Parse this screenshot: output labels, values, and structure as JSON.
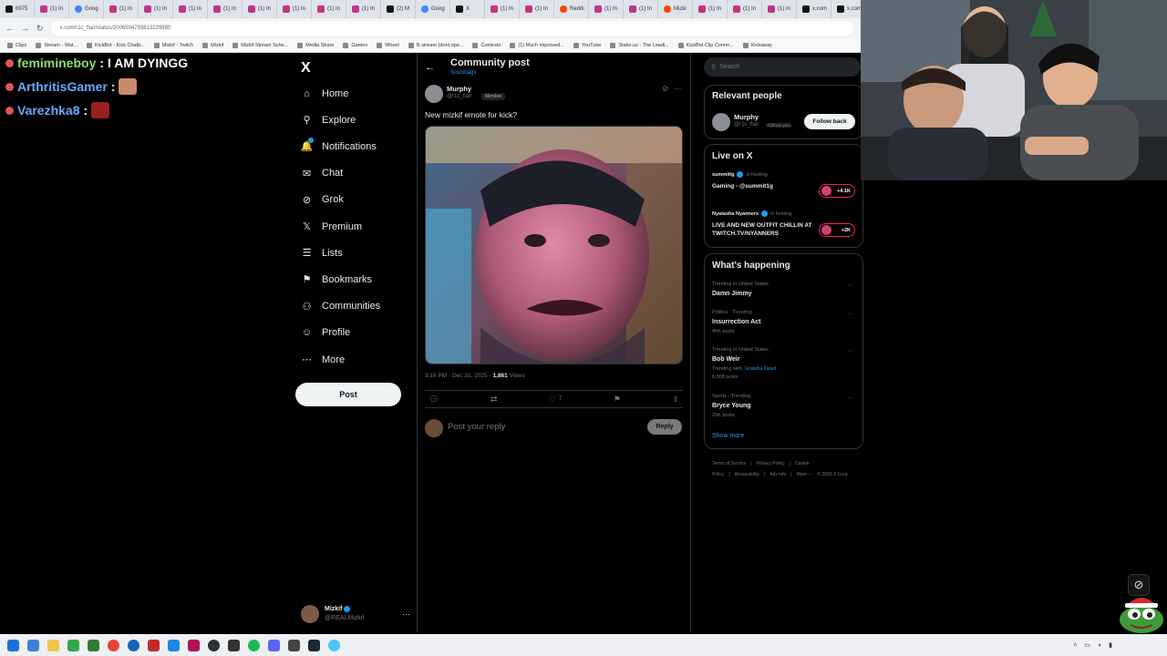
{
  "browser": {
    "tabs": [
      {
        "label": "6975",
        "icon": "x"
      },
      {
        "label": "(1) In",
        "icon": "instagram"
      },
      {
        "label": "Goog",
        "icon": "google"
      },
      {
        "label": "(1) In",
        "icon": "instagram"
      },
      {
        "label": "(1) In",
        "icon": "instagram"
      },
      {
        "label": "(1) In",
        "icon": "instagram"
      },
      {
        "label": "(1) In",
        "icon": "instagram"
      },
      {
        "label": "(1) In",
        "icon": "instagram"
      },
      {
        "label": "(1) In",
        "icon": "instagram"
      },
      {
        "label": "(1) In",
        "icon": "instagram"
      },
      {
        "label": "(1) In",
        "icon": "instagram"
      },
      {
        "label": "(2) M",
        "icon": "x"
      },
      {
        "label": "Goog",
        "icon": "google"
      },
      {
        "label": "X",
        "icon": "x"
      },
      {
        "label": "(1) In",
        "icon": "instagram"
      },
      {
        "label": "(1) In",
        "icon": "instagram"
      },
      {
        "label": "Reddi",
        "icon": "reddit"
      },
      {
        "label": "(1) In",
        "icon": "instagram"
      },
      {
        "label": "(1) In",
        "icon": "instagram"
      },
      {
        "label": "Mizki",
        "icon": "reddit"
      },
      {
        "label": "(1) In",
        "icon": "instagram"
      },
      {
        "label": "(1) In",
        "icon": "instagram"
      },
      {
        "label": "(1) In",
        "icon": "instagram"
      },
      {
        "label": "x.com",
        "icon": "x"
      },
      {
        "label": "x.com",
        "icon": "x"
      }
    ],
    "url": "x.com/r1c_flair/status/2006504793813229980",
    "bookmarks": [
      "Clips",
      "Stream - Wat...",
      "KickBot - Kick Chatb...",
      "Mizkif - Twitch",
      "Mizkif",
      "Mizkif Stream Sche...",
      "Media Share",
      "Games",
      "Wheel",
      "R.stream (dont ope...",
      "Contexto",
      "(1) Much improved...",
      "YouTube",
      "Stake.us - The Leadi...",
      "KickBot Clip Comm...",
      "Kickaway"
    ]
  },
  "stream_chat": [
    {
      "user": "femimineboy",
      "message": "I AM DYINGG",
      "color": "#8fdc6a",
      "emote": false
    },
    {
      "user": "ArthritisGamer",
      "message": "",
      "color": "#6aa7ff",
      "emote": true
    },
    {
      "user": "Varezhka8",
      "message": "",
      "color": "#6aa7ff",
      "emote": true
    }
  ],
  "sidebar": {
    "logo": "X",
    "items": [
      {
        "label": "Home",
        "icon": "home-icon",
        "glyph": "⌂"
      },
      {
        "label": "Explore",
        "icon": "search-icon",
        "glyph": "⚲"
      },
      {
        "label": "Notifications",
        "icon": "bell-icon",
        "glyph": "🔔"
      },
      {
        "label": "Chat",
        "icon": "mail-icon",
        "glyph": "✉"
      },
      {
        "label": "Grok",
        "icon": "grok-icon",
        "glyph": "⊘"
      },
      {
        "label": "Premium",
        "icon": "x-premium-icon",
        "glyph": "𝕏"
      },
      {
        "label": "Lists",
        "icon": "list-icon",
        "glyph": "☰"
      },
      {
        "label": "Bookmarks",
        "icon": "bookmark-icon",
        "glyph": "⚑"
      },
      {
        "label": "Communities",
        "icon": "people-icon",
        "glyph": "⚇"
      },
      {
        "label": "Profile",
        "icon": "person-icon",
        "glyph": "☺"
      },
      {
        "label": "More",
        "icon": "more-circle-icon",
        "glyph": "⋯"
      }
    ],
    "post_button": "Post",
    "account": {
      "name": "Mizkif",
      "handle": "@REALMizkif"
    }
  },
  "post": {
    "back_glyph": "←",
    "title": "Community post",
    "community": "Scumbags",
    "author": "Murphy",
    "handle": "@r1c_flair ·",
    "badge": "Member",
    "text": "New mizkif emote for kick?",
    "time": "3:16 PM · Dec 31, 2025 ·",
    "views_count": "1,861",
    "views_label": "Views",
    "likes": "7",
    "reply_placeholder": "Post your reply",
    "reply_button": "Reply"
  },
  "right": {
    "search_placeholder": "Search",
    "relevant_title": "Relevant people",
    "relevant": {
      "name": "Murphy",
      "handle": "@r1c_flair",
      "follows_you": "Follows you",
      "follow_button": "Follow back"
    },
    "live_title": "Live on X",
    "live": [
      {
        "host": "summitlg",
        "hosting": "is hosting",
        "title": "Gaming - @summit1g",
        "count": "+4.1K"
      },
      {
        "host": "Nyatasha Nyanners",
        "hosting": "is hosting",
        "title": "LIVE AND NEW OUTFIT CHILLIN AT TWITCH.TV/NYANNERS",
        "count": "+2K"
      }
    ],
    "happening_title": "What's happening",
    "trends": [
      {
        "meta": "Trending in United States",
        "name": "Damn Jimmy",
        "count": ""
      },
      {
        "meta": "Politics · Trending",
        "name": "Insurrection Act",
        "count": "46K posts"
      },
      {
        "meta": "Trending in United States",
        "name": "Bob Weir",
        "count": "6,808 posts",
        "extra_prefix": "Trending with",
        "extra_link": "Grateful Dead"
      },
      {
        "meta": "Sports · Trending",
        "name": "Bryce Young",
        "count": "20K posts"
      }
    ],
    "show_more": "Show more",
    "footer": [
      "Terms of Service",
      "|",
      "Privacy Policy",
      "|",
      "Cookie Policy",
      "|",
      "Accessibility",
      "|",
      "Ads info",
      "|",
      "More ···",
      "© 2026 X Corp."
    ]
  },
  "colors": {
    "accent": "#1d9bf0",
    "live": "#f91880",
    "bg": "#000000"
  }
}
